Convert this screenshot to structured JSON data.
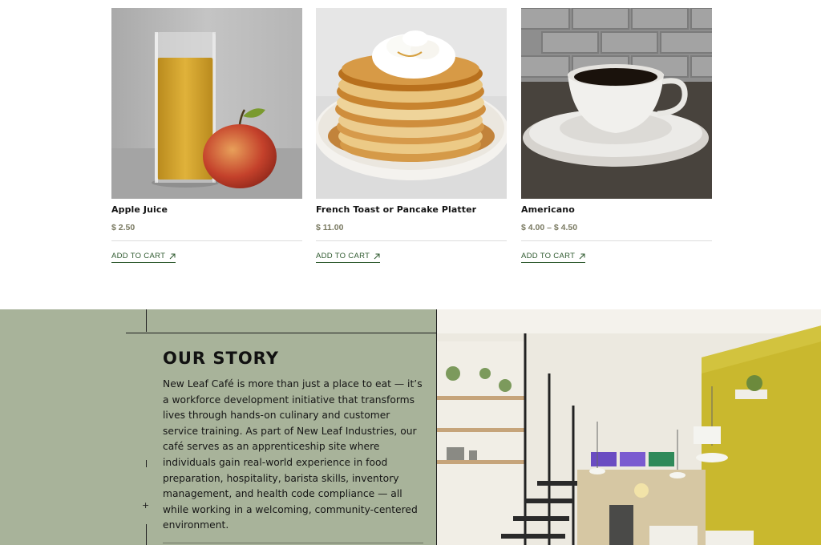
{
  "products": [
    {
      "name": "Apple Juice",
      "price": "$ 2.50",
      "cta": "ADD TO CART",
      "image": "apple-juice-photo"
    },
    {
      "name": "French Toast or Pancake Platter",
      "price": "$ 11.00",
      "cta": "ADD TO CART",
      "image": "pancake-platter-photo"
    },
    {
      "name": "Americano",
      "price": "$ 4.00 – $ 4.50",
      "cta": "ADD TO CART",
      "image": "americano-photo"
    }
  ],
  "icons": {
    "cart_link": "arrow-up-right-icon"
  },
  "story": {
    "heading": "OUR STORY",
    "body": "New Leaf Café is more than just a place to eat — it’s a workforce development initiative that transforms lives through hands-on culinary and customer service training. As part of New Leaf Industries, our café serves as an apprenticeship site where individuals gain real-world experience in food preparation, hospitality, barista skills, inventory management, and health code compliance — all while working in a welcoming, community-centered environment.",
    "image": "cafe-interior-photo"
  },
  "colors": {
    "story_bg": "#a8b39a",
    "accent_green": "#2f5a2f",
    "price_color": "#7a7a62"
  }
}
